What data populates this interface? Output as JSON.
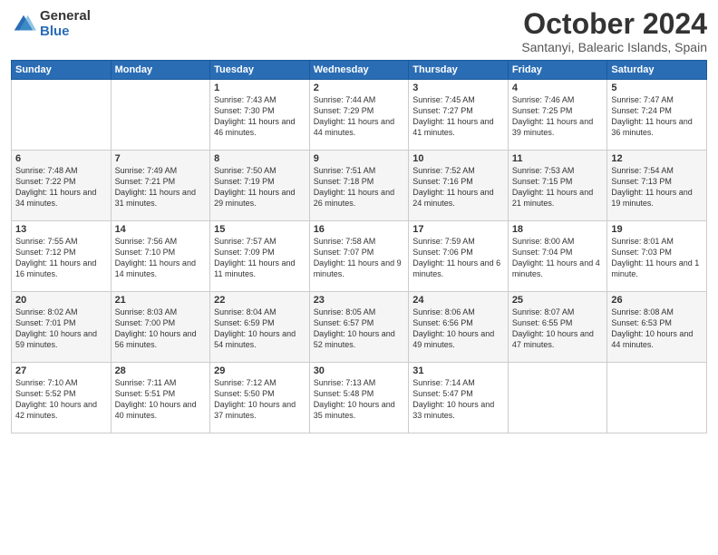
{
  "header": {
    "logo_general": "General",
    "logo_blue": "Blue",
    "month": "October 2024",
    "location": "Santanyi, Balearic Islands, Spain"
  },
  "days_of_week": [
    "Sunday",
    "Monday",
    "Tuesday",
    "Wednesday",
    "Thursday",
    "Friday",
    "Saturday"
  ],
  "weeks": [
    [
      {
        "day": "",
        "info": ""
      },
      {
        "day": "",
        "info": ""
      },
      {
        "day": "1",
        "info": "Sunrise: 7:43 AM\nSunset: 7:30 PM\nDaylight: 11 hours and 46 minutes."
      },
      {
        "day": "2",
        "info": "Sunrise: 7:44 AM\nSunset: 7:29 PM\nDaylight: 11 hours and 44 minutes."
      },
      {
        "day": "3",
        "info": "Sunrise: 7:45 AM\nSunset: 7:27 PM\nDaylight: 11 hours and 41 minutes."
      },
      {
        "day": "4",
        "info": "Sunrise: 7:46 AM\nSunset: 7:25 PM\nDaylight: 11 hours and 39 minutes."
      },
      {
        "day": "5",
        "info": "Sunrise: 7:47 AM\nSunset: 7:24 PM\nDaylight: 11 hours and 36 minutes."
      }
    ],
    [
      {
        "day": "6",
        "info": "Sunrise: 7:48 AM\nSunset: 7:22 PM\nDaylight: 11 hours and 34 minutes."
      },
      {
        "day": "7",
        "info": "Sunrise: 7:49 AM\nSunset: 7:21 PM\nDaylight: 11 hours and 31 minutes."
      },
      {
        "day": "8",
        "info": "Sunrise: 7:50 AM\nSunset: 7:19 PM\nDaylight: 11 hours and 29 minutes."
      },
      {
        "day": "9",
        "info": "Sunrise: 7:51 AM\nSunset: 7:18 PM\nDaylight: 11 hours and 26 minutes."
      },
      {
        "day": "10",
        "info": "Sunrise: 7:52 AM\nSunset: 7:16 PM\nDaylight: 11 hours and 24 minutes."
      },
      {
        "day": "11",
        "info": "Sunrise: 7:53 AM\nSunset: 7:15 PM\nDaylight: 11 hours and 21 minutes."
      },
      {
        "day": "12",
        "info": "Sunrise: 7:54 AM\nSunset: 7:13 PM\nDaylight: 11 hours and 19 minutes."
      }
    ],
    [
      {
        "day": "13",
        "info": "Sunrise: 7:55 AM\nSunset: 7:12 PM\nDaylight: 11 hours and 16 minutes."
      },
      {
        "day": "14",
        "info": "Sunrise: 7:56 AM\nSunset: 7:10 PM\nDaylight: 11 hours and 14 minutes."
      },
      {
        "day": "15",
        "info": "Sunrise: 7:57 AM\nSunset: 7:09 PM\nDaylight: 11 hours and 11 minutes."
      },
      {
        "day": "16",
        "info": "Sunrise: 7:58 AM\nSunset: 7:07 PM\nDaylight: 11 hours and 9 minutes."
      },
      {
        "day": "17",
        "info": "Sunrise: 7:59 AM\nSunset: 7:06 PM\nDaylight: 11 hours and 6 minutes."
      },
      {
        "day": "18",
        "info": "Sunrise: 8:00 AM\nSunset: 7:04 PM\nDaylight: 11 hours and 4 minutes."
      },
      {
        "day": "19",
        "info": "Sunrise: 8:01 AM\nSunset: 7:03 PM\nDaylight: 11 hours and 1 minute."
      }
    ],
    [
      {
        "day": "20",
        "info": "Sunrise: 8:02 AM\nSunset: 7:01 PM\nDaylight: 10 hours and 59 minutes."
      },
      {
        "day": "21",
        "info": "Sunrise: 8:03 AM\nSunset: 7:00 PM\nDaylight: 10 hours and 56 minutes."
      },
      {
        "day": "22",
        "info": "Sunrise: 8:04 AM\nSunset: 6:59 PM\nDaylight: 10 hours and 54 minutes."
      },
      {
        "day": "23",
        "info": "Sunrise: 8:05 AM\nSunset: 6:57 PM\nDaylight: 10 hours and 52 minutes."
      },
      {
        "day": "24",
        "info": "Sunrise: 8:06 AM\nSunset: 6:56 PM\nDaylight: 10 hours and 49 minutes."
      },
      {
        "day": "25",
        "info": "Sunrise: 8:07 AM\nSunset: 6:55 PM\nDaylight: 10 hours and 47 minutes."
      },
      {
        "day": "26",
        "info": "Sunrise: 8:08 AM\nSunset: 6:53 PM\nDaylight: 10 hours and 44 minutes."
      }
    ],
    [
      {
        "day": "27",
        "info": "Sunrise: 7:10 AM\nSunset: 5:52 PM\nDaylight: 10 hours and 42 minutes."
      },
      {
        "day": "28",
        "info": "Sunrise: 7:11 AM\nSunset: 5:51 PM\nDaylight: 10 hours and 40 minutes."
      },
      {
        "day": "29",
        "info": "Sunrise: 7:12 AM\nSunset: 5:50 PM\nDaylight: 10 hours and 37 minutes."
      },
      {
        "day": "30",
        "info": "Sunrise: 7:13 AM\nSunset: 5:48 PM\nDaylight: 10 hours and 35 minutes."
      },
      {
        "day": "31",
        "info": "Sunrise: 7:14 AM\nSunset: 5:47 PM\nDaylight: 10 hours and 33 minutes."
      },
      {
        "day": "",
        "info": ""
      },
      {
        "day": "",
        "info": ""
      }
    ]
  ]
}
